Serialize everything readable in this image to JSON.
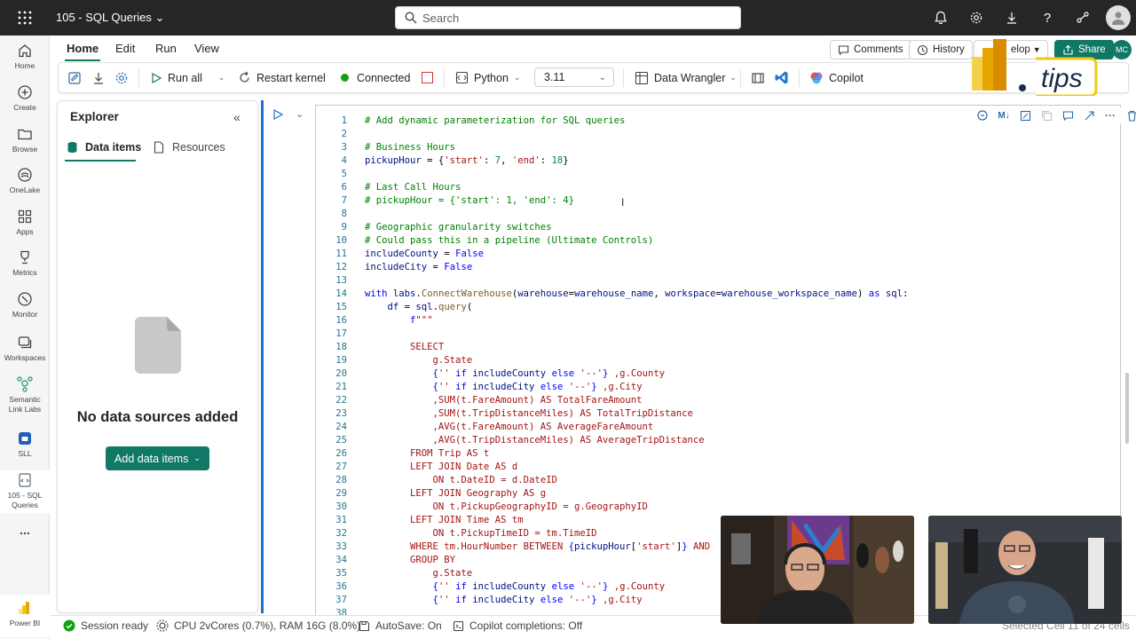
{
  "topbar": {
    "workspace_title": "105 - SQL Queries",
    "search_placeholder": "Search",
    "icons": [
      "waffle-icon",
      "bell-icon",
      "gear-icon",
      "download-icon",
      "help-icon",
      "share-network-icon",
      "avatar"
    ]
  },
  "rail": {
    "items": [
      {
        "label": "Home",
        "icon": "home-icon"
      },
      {
        "label": "Create",
        "icon": "plus-circle-icon"
      },
      {
        "label": "Browse",
        "icon": "folder-icon"
      },
      {
        "label": "OneLake",
        "icon": "onelake-icon"
      },
      {
        "label": "Apps",
        "icon": "apps-icon"
      },
      {
        "label": "Metrics",
        "icon": "trophy-icon"
      },
      {
        "label": "Monitor",
        "icon": "monitor-icon"
      },
      {
        "label": "Workspaces",
        "icon": "workspaces-icon"
      },
      {
        "label": "Semantic Link Labs",
        "icon": "semantic-link-icon"
      },
      {
        "label": "SLL",
        "icon": "sll-icon"
      },
      {
        "label": "105 - SQL Queries",
        "icon": "notebook-icon"
      },
      {
        "label": "...",
        "icon": "more-icon"
      },
      {
        "label": "Power BI",
        "icon": "powerbi-icon"
      }
    ]
  },
  "ribbon": {
    "tabs": [
      "Home",
      "Edit",
      "Run",
      "View"
    ],
    "top_actions": {
      "comments": "Comments",
      "history": "History",
      "develop": "elop",
      "share": "Share",
      "user_initials": "MC"
    },
    "run_all": "Run all",
    "restart_kernel": "Restart kernel",
    "connected": "Connected",
    "language": "Python",
    "version": "3.11",
    "data_wrangler": "Data Wrangler",
    "copilot": "Copilot",
    "colors": {
      "connected_dot": "#13a10e",
      "accent": "#117865",
      "share": "#117865"
    }
  },
  "explorer": {
    "title": "Explorer",
    "tabs": [
      "Data items",
      "Resources"
    ],
    "empty_message": "No data sources added",
    "add_button": "Add data items"
  },
  "code_lines": [
    [
      {
        "c": "cm",
        "t": "# Add dynamic parameterization for SQL queries"
      }
    ],
    [],
    [
      {
        "c": "cm",
        "t": "# Business Hours"
      }
    ],
    [
      {
        "c": "var",
        "t": "pickupHour"
      },
      {
        "c": "",
        "t": " = {"
      },
      {
        "c": "st",
        "t": "'start'"
      },
      {
        "c": "",
        "t": ": "
      },
      {
        "c": "nm",
        "t": "7"
      },
      {
        "c": "",
        "t": ", "
      },
      {
        "c": "st",
        "t": "'end'"
      },
      {
        "c": "",
        "t": ": "
      },
      {
        "c": "nm",
        "t": "18"
      },
      {
        "c": "",
        "t": "}"
      }
    ],
    [],
    [
      {
        "c": "cm",
        "t": "# Last Call Hours"
      }
    ],
    [
      {
        "c": "cm",
        "t": "# pickupHour = {'start': 1, 'end': 4}"
      }
    ],
    [],
    [
      {
        "c": "cm",
        "t": "# Geographic granularity switches"
      }
    ],
    [
      {
        "c": "cm",
        "t": "# Could pass this in a pipeline (Ultimate Controls)"
      }
    ],
    [
      {
        "c": "var",
        "t": "includeCounty"
      },
      {
        "c": "",
        "t": " = "
      },
      {
        "c": "kw",
        "t": "False"
      }
    ],
    [
      {
        "c": "var",
        "t": "includeCity"
      },
      {
        "c": "",
        "t": " = "
      },
      {
        "c": "kw",
        "t": "False"
      }
    ],
    [],
    [
      {
        "c": "kw",
        "t": "with"
      },
      {
        "c": "",
        "t": " "
      },
      {
        "c": "var",
        "t": "labs"
      },
      {
        "c": "",
        "t": "."
      },
      {
        "c": "fn",
        "t": "ConnectWarehouse"
      },
      {
        "c": "",
        "t": "("
      },
      {
        "c": "var",
        "t": "warehouse"
      },
      {
        "c": "",
        "t": "="
      },
      {
        "c": "var",
        "t": "warehouse_name"
      },
      {
        "c": "",
        "t": ", "
      },
      {
        "c": "var",
        "t": "workspace"
      },
      {
        "c": "",
        "t": "="
      },
      {
        "c": "var",
        "t": "warehouse_workspace_name"
      },
      {
        "c": "",
        "t": ") "
      },
      {
        "c": "kw",
        "t": "as"
      },
      {
        "c": "",
        "t": " "
      },
      {
        "c": "var",
        "t": "sql"
      },
      {
        "c": "",
        "t": ":"
      }
    ],
    [
      {
        "c": "",
        "t": "    "
      },
      {
        "c": "var",
        "t": "df"
      },
      {
        "c": "",
        "t": " = "
      },
      {
        "c": "var",
        "t": "sql"
      },
      {
        "c": "",
        "t": "."
      },
      {
        "c": "fn",
        "t": "query"
      },
      {
        "c": "",
        "t": "("
      }
    ],
    [
      {
        "c": "",
        "t": "        "
      },
      {
        "c": "kw",
        "t": "f"
      },
      {
        "c": "st",
        "t": "\"\"\""
      }
    ],
    [],
    [
      {
        "c": "st",
        "t": "        SELECT"
      }
    ],
    [
      {
        "c": "st",
        "t": "            g.State"
      }
    ],
    [
      {
        "c": "st",
        "t": "            "
      },
      {
        "c": "kw",
        "t": "{"
      },
      {
        "c": "st",
        "t": "''"
      },
      {
        "c": "",
        "t": " "
      },
      {
        "c": "kw",
        "t": "if"
      },
      {
        "c": "",
        "t": " "
      },
      {
        "c": "var",
        "t": "includeCounty"
      },
      {
        "c": "",
        "t": " "
      },
      {
        "c": "kw",
        "t": "else"
      },
      {
        "c": "",
        "t": " "
      },
      {
        "c": "st",
        "t": "'--'"
      },
      {
        "c": "kw",
        "t": "}"
      },
      {
        "c": "st",
        "t": " ,g.County"
      }
    ],
    [
      {
        "c": "st",
        "t": "            "
      },
      {
        "c": "kw",
        "t": "{"
      },
      {
        "c": "st",
        "t": "''"
      },
      {
        "c": "",
        "t": " "
      },
      {
        "c": "kw",
        "t": "if"
      },
      {
        "c": "",
        "t": " "
      },
      {
        "c": "var",
        "t": "includeCity"
      },
      {
        "c": "",
        "t": " "
      },
      {
        "c": "kw",
        "t": "else"
      },
      {
        "c": "",
        "t": " "
      },
      {
        "c": "st",
        "t": "'--'"
      },
      {
        "c": "kw",
        "t": "}"
      },
      {
        "c": "st",
        "t": " ,g.City"
      }
    ],
    [
      {
        "c": "st",
        "t": "            ,SUM(t.FareAmount) AS TotalFareAmount"
      }
    ],
    [
      {
        "c": "st",
        "t": "            ,SUM(t.TripDistanceMiles) AS TotalTripDistance"
      }
    ],
    [
      {
        "c": "st",
        "t": "            ,AVG(t.FareAmount) AS AverageFareAmount"
      }
    ],
    [
      {
        "c": "st",
        "t": "            ,AVG(t.TripDistanceMiles) AS AverageTripDistance"
      }
    ],
    [
      {
        "c": "st",
        "t": "        FROM Trip AS t"
      }
    ],
    [
      {
        "c": "st",
        "t": "        LEFT JOIN Date AS d"
      }
    ],
    [
      {
        "c": "st",
        "t": "            ON t.DateID = d.DateID"
      }
    ],
    [
      {
        "c": "st",
        "t": "        LEFT JOIN Geography AS g"
      }
    ],
    [
      {
        "c": "st",
        "t": "            ON t.PickupGeographyID = g.GeographyID"
      }
    ],
    [
      {
        "c": "st",
        "t": "        LEFT JOIN Time AS tm"
      }
    ],
    [
      {
        "c": "st",
        "t": "            ON t.PickupTimeID = tm.TimeID"
      }
    ],
    [
      {
        "c": "st",
        "t": "        WHERE tm.HourNumber BETWEEN "
      },
      {
        "c": "kw",
        "t": "{"
      },
      {
        "c": "var",
        "t": "pickupHour"
      },
      {
        "c": "",
        "t": "["
      },
      {
        "c": "st",
        "t": "'start'"
      },
      {
        "c": "",
        "t": "]"
      },
      {
        "c": "kw",
        "t": "}"
      },
      {
        "c": "st",
        "t": " AND "
      }
    ],
    [
      {
        "c": "st",
        "t": "        GROUP BY"
      }
    ],
    [
      {
        "c": "st",
        "t": "            g.State"
      }
    ],
    [
      {
        "c": "st",
        "t": "            "
      },
      {
        "c": "kw",
        "t": "{"
      },
      {
        "c": "st",
        "t": "''"
      },
      {
        "c": "",
        "t": " "
      },
      {
        "c": "kw",
        "t": "if"
      },
      {
        "c": "",
        "t": " "
      },
      {
        "c": "var",
        "t": "includeCounty"
      },
      {
        "c": "",
        "t": " "
      },
      {
        "c": "kw",
        "t": "else"
      },
      {
        "c": "",
        "t": " "
      },
      {
        "c": "st",
        "t": "'--'"
      },
      {
        "c": "kw",
        "t": "}"
      },
      {
        "c": "st",
        "t": " ,g.County"
      }
    ],
    [
      {
        "c": "st",
        "t": "            "
      },
      {
        "c": "kw",
        "t": "{"
      },
      {
        "c": "st",
        "t": "''"
      },
      {
        "c": "",
        "t": " "
      },
      {
        "c": "kw",
        "t": "if"
      },
      {
        "c": "",
        "t": " "
      },
      {
        "c": "var",
        "t": "includeCity"
      },
      {
        "c": "",
        "t": " "
      },
      {
        "c": "kw",
        "t": "else"
      },
      {
        "c": "",
        "t": " "
      },
      {
        "c": "st",
        "t": "'--'"
      },
      {
        "c": "kw",
        "t": "}"
      },
      {
        "c": "st",
        "t": " ,g.City"
      }
    ],
    []
  ],
  "status": {
    "session": "Session ready",
    "cpu": "CPU 2vCores (0.7%), RAM 16G (8.0%)",
    "autosave": "AutoSave: On",
    "copilot": "Copilot completions: Off",
    "selected_cell": "Selected Cell 11 of 24 cells"
  },
  "logo": {
    "text": "tips"
  }
}
